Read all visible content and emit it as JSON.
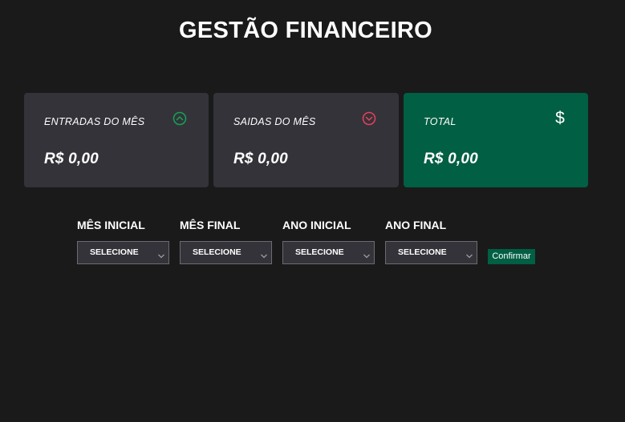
{
  "header": {
    "title": "GESTÃO FINANCEIRO"
  },
  "cards": [
    {
      "label": "ENTRADAS DO MÊS",
      "value": "R$ 0,00",
      "icon": "arrow-up-circle-icon",
      "icon_color": "#12a454"
    },
    {
      "label": "SAIDAS DO MÊS",
      "value": "R$ 0,00",
      "icon": "arrow-down-circle-icon",
      "icon_color": "#e83f5b"
    },
    {
      "label": "TOTAL",
      "value": "R$ 0,00",
      "icon": "dollar-sign-icon",
      "icon_glyph": "$",
      "background": "#015f43"
    }
  ],
  "filters": [
    {
      "label": "MÊS INICIAL",
      "selected": "SELECIONE"
    },
    {
      "label": "MÊS FINAL",
      "selected": "SELECIONE"
    },
    {
      "label": "ANO INICIAL",
      "selected": "SELECIONE"
    },
    {
      "label": "ANO FINAL",
      "selected": "SELECIONE"
    }
  ],
  "actions": {
    "confirm_label": "Confirmar"
  },
  "colors": {
    "background": "#1a1a1b",
    "card": "#34333a",
    "accent": "#015f43",
    "income": "#12a454",
    "outcome": "#e83f5b"
  }
}
